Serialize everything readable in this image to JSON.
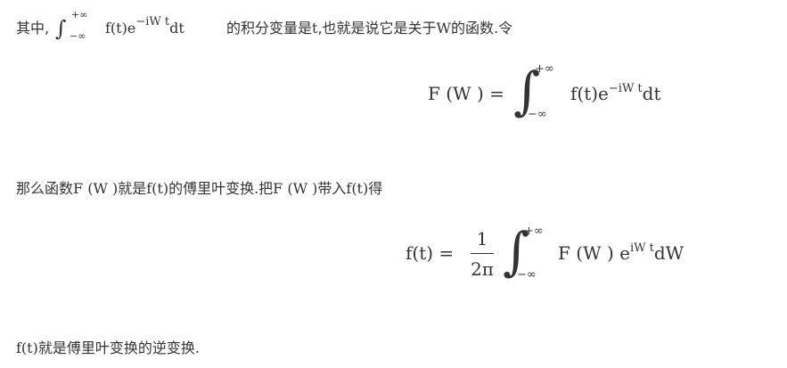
{
  "p1": {
    "prefix": "其中,",
    "int_upper": "+∞",
    "int_lower": "−∞",
    "integrand": "f(t)e",
    "exp": "−iW t",
    "dt": "dt",
    "suffix_a": "的积分变量是",
    "suffix_b": "t",
    "suffix_c": ",也就是说它是关于",
    "suffix_d": "W",
    "suffix_e": "的函数.令"
  },
  "eq1": {
    "lhs": "F (W ) =",
    "upper": "+∞",
    "lower": "−∞",
    "integrand": "f(t)e",
    "exp": "−iW t",
    "dt": "dt"
  },
  "p2": {
    "a": "那么函数",
    "b": "F (W )",
    "c": "就是",
    "d": "f(t)",
    "e": "的傅里叶变换.把",
    "f": "F (W )",
    "g": "带入",
    "h": "f(t)",
    "i": "得"
  },
  "eq2": {
    "lhs": "f(t) =",
    "num": "1",
    "den": "2π",
    "upper": "+∞",
    "lower": "−∞",
    "integrand": "F (W ) e",
    "exp": "iW t",
    "dw": "dW"
  },
  "p3": {
    "a": "f(t)",
    "b": "就是傅里叶变换的逆变换."
  }
}
